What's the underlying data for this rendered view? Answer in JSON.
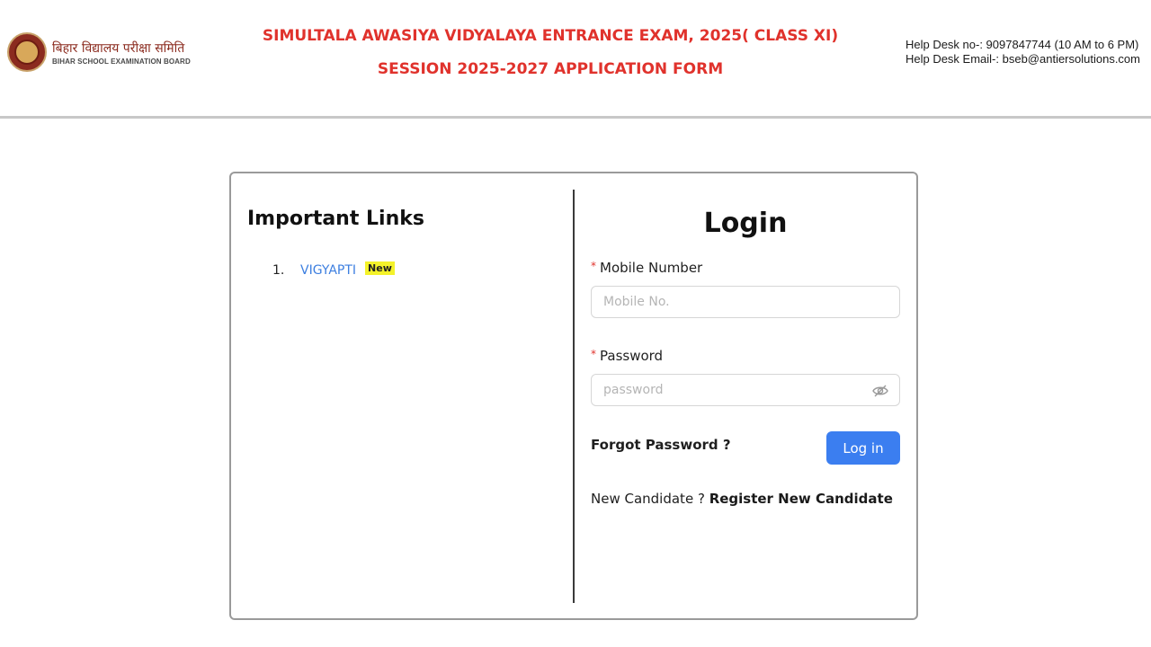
{
  "header": {
    "org_name_hindi": "बिहार विद्यालय परीक्षा समिति",
    "org_name_english": "BIHAR SCHOOL EXAMINATION BOARD",
    "title_line1": "SIMULTALA AWASIYA VIDYALAYA ENTRANCE EXAM, 2025( CLASS XI)",
    "title_line2": "SESSION 2025-2027 APPLICATION FORM",
    "helpdesk_phone": "Help Desk no-: 9097847744 (10 AM to 6 PM)",
    "helpdesk_email": "Help Desk Email-: bseb@antiersolutions.com",
    "title_color": "#e0322c"
  },
  "important_links": {
    "title": "Important Links",
    "items": [
      {
        "number": "1.",
        "label": "VIGYAPTI",
        "badge": "New"
      }
    ]
  },
  "login": {
    "title": "Login",
    "mobile_label": "Mobile Number",
    "mobile_placeholder": "Mobile No.",
    "mobile_value": "",
    "password_label": "Password",
    "password_placeholder": "password",
    "password_value": "",
    "required_marker": "*",
    "forgot_label": "Forgot Password ?",
    "submit_label": "Log in",
    "new_candidate_text": "New Candidate ?",
    "register_label": "Register New Candidate",
    "password_toggle_icon": "eye-invisible-icon",
    "button_color": "#3b7ef0"
  }
}
